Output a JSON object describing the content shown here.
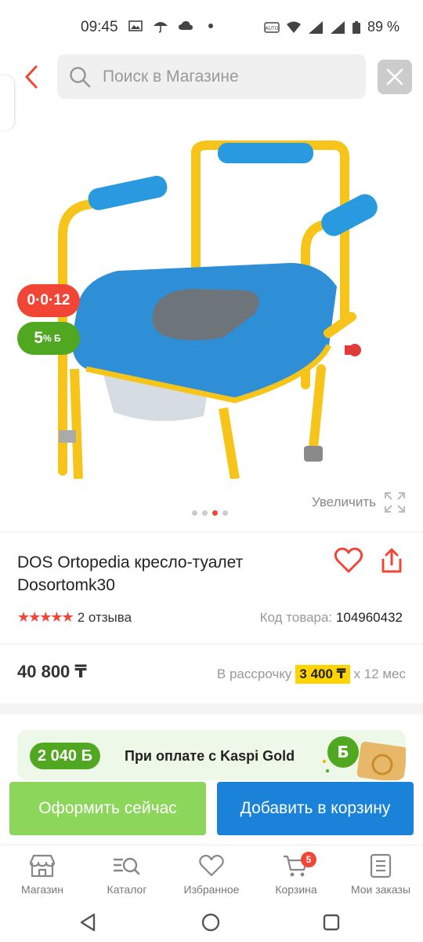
{
  "status_bar": {
    "time": "09:45",
    "battery": "89 %",
    "icons": [
      "image-icon",
      "umbrella-icon",
      "cloud-icon",
      "dot-icon",
      "auto-icon",
      "wifi-icon",
      "signal-1-icon",
      "signal-2-icon",
      "battery-icon"
    ]
  },
  "search": {
    "placeholder": "Поиск в Магазине"
  },
  "gallery": {
    "installment_badge": "0·0·12",
    "bonus_badge_value": "5",
    "bonus_badge_suffix": "% Б",
    "zoom_label": "Увеличить",
    "dots_count": 4,
    "active_dot": 2
  },
  "product": {
    "title": "DOS Ortopedia кресло-туалет Dosortomk30",
    "stars": "★★★★★",
    "reviews": "2 отзыва",
    "code_label": "Код товара:",
    "code_value": "104960432",
    "price": "40 800 ₸",
    "installment_prefix": "В рассрочку",
    "installment_amount": "3 400 ₸",
    "installment_suffix": "x 12 мес"
  },
  "promo": {
    "bonus": "2 040 Б",
    "text": "При оплате с Kaspi Gold"
  },
  "actions": {
    "buy_now": "Оформить сейчас",
    "add_to_cart": "Добавить в корзину"
  },
  "bottom_nav": {
    "items": [
      {
        "label": "Магазин",
        "icon": "store-icon"
      },
      {
        "label": "Каталог",
        "icon": "catalog-search-icon"
      },
      {
        "label": "Избранное",
        "icon": "heart-icon"
      },
      {
        "label": "Корзина",
        "icon": "cart-icon",
        "badge": "5"
      },
      {
        "label": "Мои заказы",
        "icon": "orders-icon"
      }
    ]
  },
  "colors": {
    "accent_red": "#f14635",
    "bonus_green": "#4fa81f",
    "buy_green": "#8dd65c",
    "cart_blue": "#1a82d9",
    "installment_yellow": "#ffd400"
  }
}
